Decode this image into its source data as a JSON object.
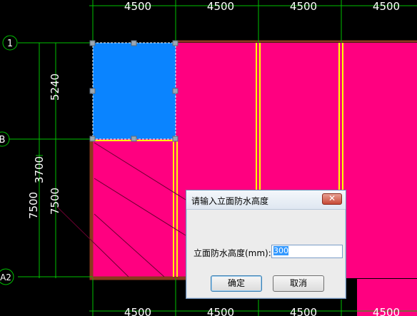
{
  "drawing": {
    "top_dims": [
      "4500",
      "4500",
      "4500",
      "4500"
    ],
    "bottom_dims": [
      "4500",
      "4500",
      "4500",
      "4500"
    ],
    "left_dims": [
      "5240",
      "3700",
      "7500",
      "7500"
    ],
    "axes": [
      "1",
      "B",
      "A2"
    ],
    "colors": {
      "fill": "#ff0080",
      "selected": "#0a84ff",
      "dim_line": "#00c000",
      "beam": "#ffff00",
      "frame": "#8a3a1e",
      "text": "#ffffff"
    }
  },
  "dialog": {
    "title": "请输入立面防水高度",
    "close_icon": "close-icon",
    "label": "立面防水高度(mm):",
    "value": "300",
    "ok": "确定",
    "cancel": "取消"
  }
}
